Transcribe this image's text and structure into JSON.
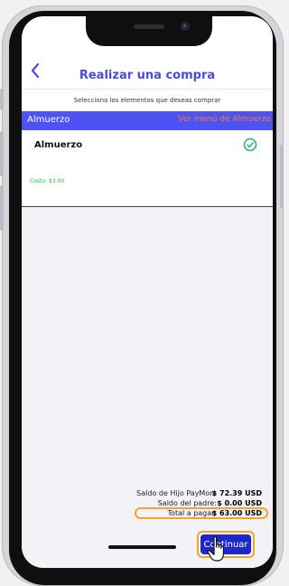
{
  "header": {
    "back_icon": "chevron-left-icon",
    "title": "Realizar una compra"
  },
  "instruction": "Selecciona los elementos que deseas comprar",
  "category": {
    "name": "Almuerzo",
    "menu_link": "Ver menú de Almuerzo"
  },
  "item": {
    "name": "Almuerzo",
    "cost": "Costo: $3.00",
    "selected_icon": "check-circle-icon",
    "selected": true
  },
  "summary": {
    "child_balance_label": "Saldo de Hijo PayMon:",
    "child_balance_value": "$ 72.39 USD",
    "parent_balance_label": "Saldo del padre:",
    "parent_balance_value": "$ 0.00 USD",
    "total_label": "Total a pagar:",
    "total_value": "$ 63.00 USD"
  },
  "continue_button": {
    "label": "Continuar"
  },
  "cursor_icon": "hand-pointer-icon",
  "colors": {
    "accent": "#4a4ae0",
    "category_bar": "#4d52f2",
    "link_orange": "#ff7a3c",
    "cost_green": "#2db34a",
    "highlight_orange": "#f2a52a",
    "button_blue": "#1e28c8"
  }
}
